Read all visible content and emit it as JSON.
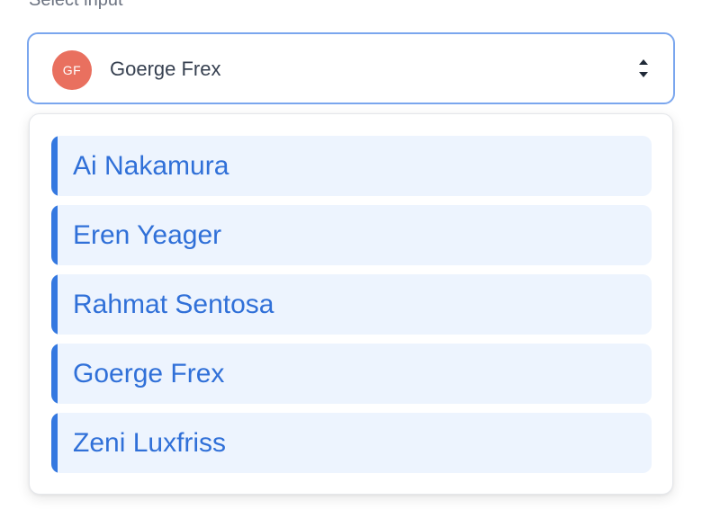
{
  "field": {
    "label": "Select input"
  },
  "select": {
    "avatar_initials": "GF",
    "selected_value": "Goerge Frex",
    "avatar_color": "#e9705f",
    "border_color": "#7aa6ee",
    "icon": "chevron-up-down-icon"
  },
  "dropdown": {
    "accent_color": "#3478e0",
    "option_bg": "#edf4fe",
    "options": [
      {
        "label": "Ai Nakamura"
      },
      {
        "label": "Eren Yeager"
      },
      {
        "label": "Rahmat Sentosa"
      },
      {
        "label": "Goerge Frex"
      },
      {
        "label": "Zeni Luxfriss"
      }
    ]
  }
}
